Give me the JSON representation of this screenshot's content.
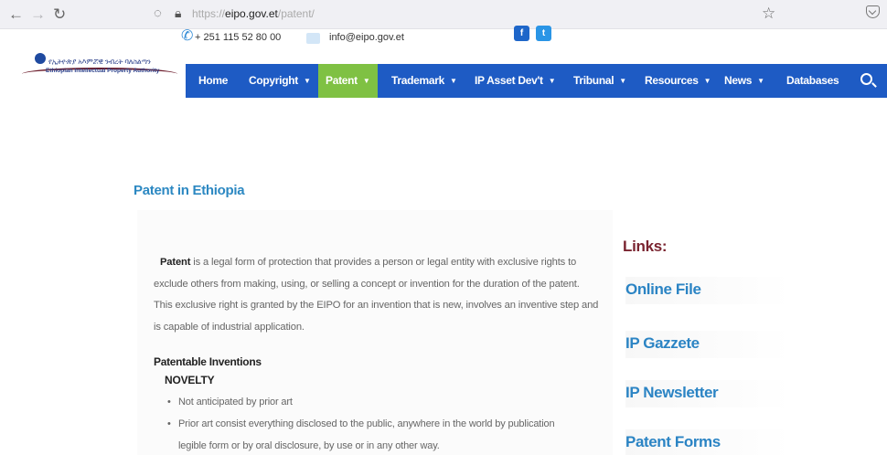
{
  "browser": {
    "url_prefix": "https://",
    "url_domain": "eipo.gov.et",
    "url_path": "/patent/"
  },
  "header": {
    "logo": {
      "amharic": "የኢትዮጵያ አእምሯዊ ንብረት ባለስልጣን",
      "english": "Ethiopian Intellectual Property Authority"
    },
    "phone": "+ 251 115 52 80 00",
    "email": "info@eipo.gov.et",
    "facebook_glyph": "f",
    "twitter_glyph": "t"
  },
  "nav": {
    "items": [
      {
        "label": "Home",
        "has_caret": false,
        "active": false
      },
      {
        "label": "Copyright",
        "has_caret": true,
        "active": false
      },
      {
        "label": "Patent",
        "has_caret": true,
        "active": true
      },
      {
        "label": "Trademark",
        "has_caret": true,
        "active": false
      },
      {
        "label": "IP Asset Dev't",
        "has_caret": true,
        "active": false
      },
      {
        "label": "Tribunal",
        "has_caret": true,
        "active": false
      },
      {
        "label": "Resources",
        "has_caret": true,
        "active": false
      },
      {
        "label": "News",
        "has_caret": true,
        "active": false
      },
      {
        "label": "Databases",
        "has_caret": false,
        "active": false
      }
    ],
    "caret": "▼"
  },
  "page": {
    "title": "Patent in Ethiopia",
    "intro_bold": "Patent",
    "intro_rest": " is a legal form of protection that provides a person or legal entity with exclusive rights to exclude others from making, using, or selling a concept or invention for the duration of the patent. This exclusive right is granted by the EIPO for an invention that is new, involves an inventive step and is capable of industrial application.",
    "patentable_heading": "Patentable Inventions",
    "novelty_heading": "NOVELTY",
    "bullets": [
      "Not anticipated by prior art",
      "Prior art consist everything disclosed to the public, anywhere in the world by publication",
      "legible form or by oral disclosure, by use or in any other way."
    ]
  },
  "sidebar": {
    "heading": "Links:",
    "links": [
      "Online File",
      "IP Gazzete",
      "IP Newsletter",
      "Patent Forms"
    ]
  },
  "colors": {
    "nav_bg": "#1e5bc4",
    "nav_active": "#7fc143",
    "link_blue": "#2b84c4",
    "links_heading": "#7a2430"
  }
}
